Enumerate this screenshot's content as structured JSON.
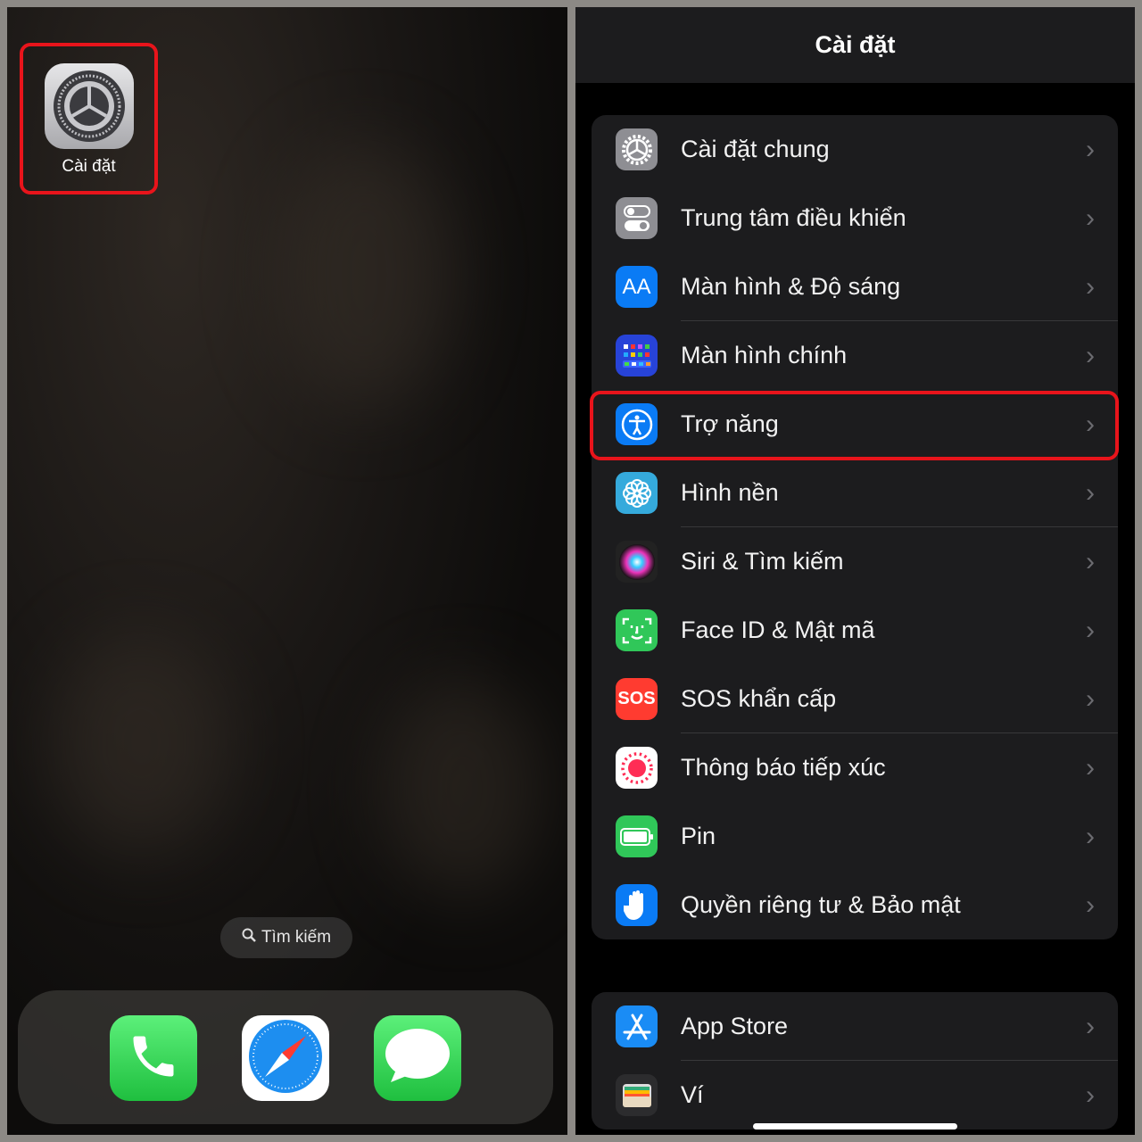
{
  "home": {
    "settings_app": {
      "label": "Cài đặt",
      "icon": "gear-icon"
    },
    "search": {
      "label": "Tìm kiếm",
      "icon": "magnifier-icon"
    },
    "dock": [
      {
        "name": "phone",
        "icon": "phone-icon",
        "color": "#2fd158"
      },
      {
        "name": "safari",
        "icon": "compass-icon",
        "color": "#ffffff"
      },
      {
        "name": "messages",
        "icon": "speech-bubble-icon",
        "color": "#2fd158"
      }
    ]
  },
  "settings": {
    "title": "Cài đặt",
    "group1": [
      {
        "label": "Cài đặt chung",
        "icon": "gear-icon",
        "color": "#8e8e93"
      },
      {
        "label": "Trung tâm điều khiển",
        "icon": "toggles-icon",
        "color": "#8e8e93"
      },
      {
        "label": "Màn hình & Độ sáng",
        "icon": "text-size-icon",
        "color": "#0a7bf5"
      },
      {
        "label": "Màn hình chính",
        "icon": "app-grid-icon",
        "color": "#2743d8"
      },
      {
        "label": "Trợ năng",
        "icon": "accessibility-icon",
        "color": "#0a7bf5",
        "highlighted": true
      },
      {
        "label": "Hình nền",
        "icon": "flower-icon",
        "color": "#35aadc"
      },
      {
        "label": "Siri & Tìm kiếm",
        "icon": "siri-icon",
        "color": "#222"
      },
      {
        "label": "Face ID & Mật mã",
        "icon": "face-id-icon",
        "color": "#30c759"
      },
      {
        "label": "SOS khẩn cấp",
        "icon": "sos-icon",
        "color": "#ff3b30"
      },
      {
        "label": "Thông báo tiếp xúc",
        "icon": "exposure-icon",
        "color": "#ffffff"
      },
      {
        "label": "Pin",
        "icon": "battery-icon",
        "color": "#30c759"
      },
      {
        "label": "Quyền riêng tư & Bảo mật",
        "icon": "hand-icon",
        "color": "#0a7bf5"
      }
    ],
    "group2": [
      {
        "label": "App Store",
        "icon": "app-store-icon",
        "color": "#1a8cf5"
      },
      {
        "label": "Ví",
        "icon": "wallet-icon",
        "color": "#2c2c2e"
      }
    ],
    "sos_text": "SOS",
    "aa_text": "AA"
  },
  "highlight_color": "#e8141b"
}
